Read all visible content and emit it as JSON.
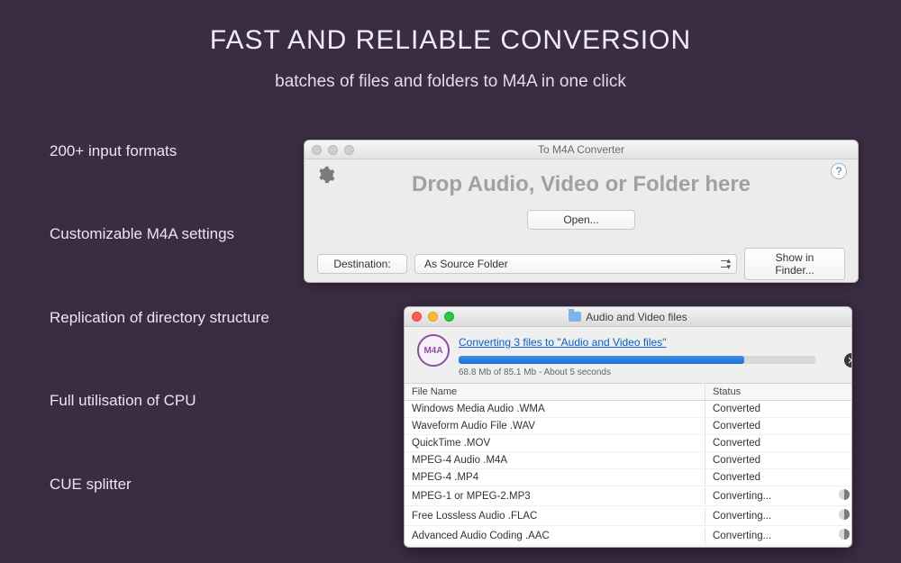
{
  "hero": {
    "title": "FAST AND RELIABLE CONVERSION",
    "subtitle": "batches of files and folders to M4A in one click"
  },
  "features": [
    "200+ input formats",
    "Customizable M4A settings",
    "Replication of directory structure",
    "Full utilisation of CPU",
    "CUE splitter"
  ],
  "dropWindow": {
    "title": "To M4A Converter",
    "dropText": "Drop Audio, Video or Folder here",
    "openLabel": "Open...",
    "destinationLabel": "Destination:",
    "destinationValue": "As Source Folder",
    "showInFinderLabel": "Show in Finder..."
  },
  "progressWindow": {
    "title": "Audio and Video files",
    "badge": "M4A",
    "convertingLink": "Converting 3 files to \"Audio and Video files\"",
    "progressPercent": 80,
    "statusText": "68.8 Mb of 85.1 Mb - About 5 seconds",
    "columns": {
      "name": "File Name",
      "status": "Status"
    },
    "rows": [
      {
        "name": "Windows Media Audio .WMA",
        "status": "Converted",
        "busy": false
      },
      {
        "name": "Waveform Audio File .WAV",
        "status": "Converted",
        "busy": false
      },
      {
        "name": "QuickTime .MOV",
        "status": "Converted",
        "busy": false
      },
      {
        "name": "MPEG-4 Audio .M4A",
        "status": "Converted",
        "busy": false
      },
      {
        "name": "MPEG-4 .MP4",
        "status": "Converted",
        "busy": false
      },
      {
        "name": "MPEG-1 or MPEG-2.MP3",
        "status": "Converting...",
        "busy": true
      },
      {
        "name": "Free Lossless Audio .FLAC",
        "status": "Converting...",
        "busy": true
      },
      {
        "name": "Advanced Audio Coding .AAC",
        "status": "Converting...",
        "busy": true
      }
    ]
  }
}
